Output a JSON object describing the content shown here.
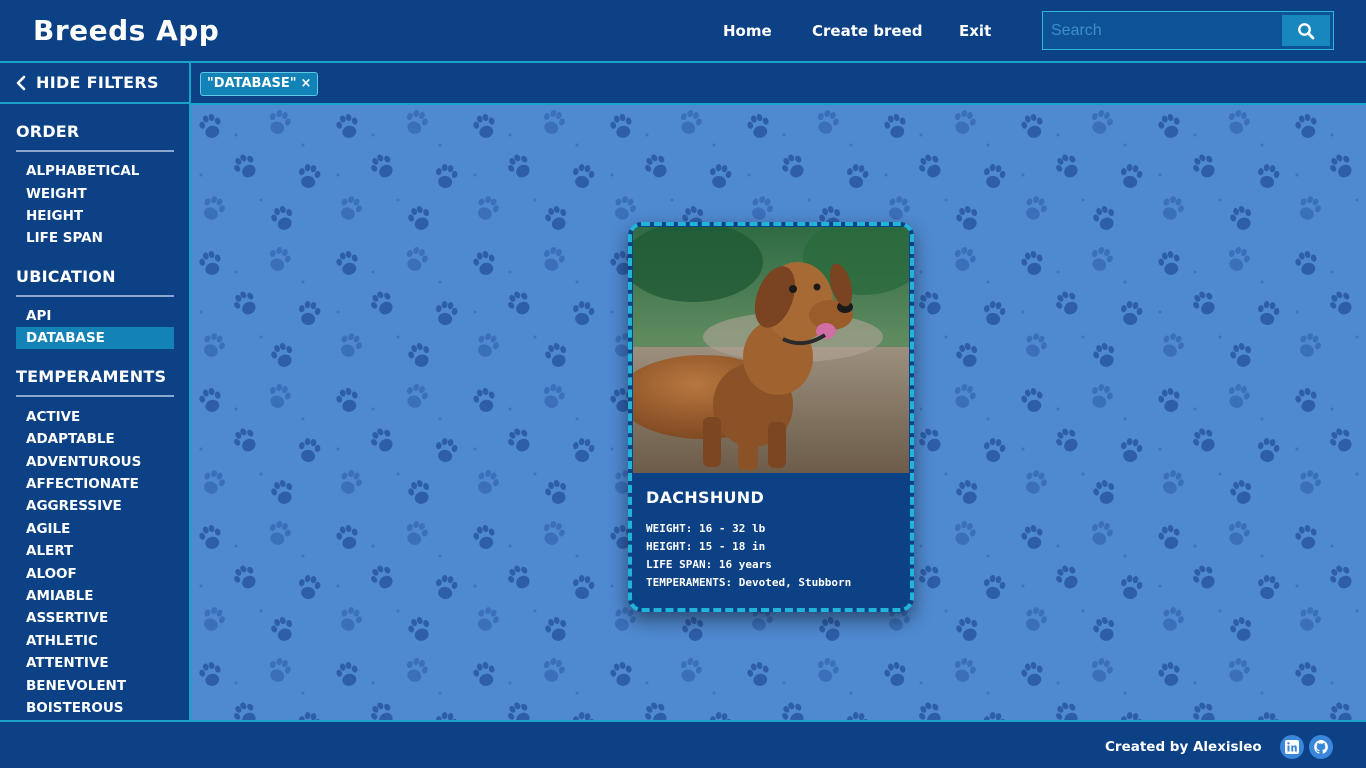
{
  "app": {
    "title": "Breeds App"
  },
  "nav": {
    "home": "Home",
    "create": "Create breed",
    "exit": "Exit"
  },
  "search": {
    "placeholder": "Search",
    "value": ""
  },
  "sidebar": {
    "toggle_label": "HIDE FILTERS",
    "order": {
      "title": "ORDER",
      "items": [
        "ALPHABETICAL",
        "WEIGHT",
        "HEIGHT",
        "LIFE SPAN"
      ]
    },
    "ubication": {
      "title": "UBICATION",
      "items": [
        "API",
        "DATABASE"
      ],
      "selected": "DATABASE"
    },
    "temperaments": {
      "title": "TEMPERAMENTS",
      "items": [
        "ACTIVE",
        "ADAPTABLE",
        "ADVENTUROUS",
        "AFFECTIONATE",
        "AGGRESSIVE",
        "AGILE",
        "ALERT",
        "ALOOF",
        "AMIABLE",
        "ASSERTIVE",
        "ATHLETIC",
        "ATTENTIVE",
        "BENEVOLENT",
        "BOISTEROUS"
      ]
    }
  },
  "active_filters": [
    {
      "label": "\"DATABASE\"",
      "close": "×"
    }
  ],
  "cards": [
    {
      "name": "DACHSHUND",
      "weight": "WEIGHT: 16 - 32 lb",
      "height": "HEIGHT: 15 - 18 in",
      "life_span": "LIFE SPAN: 16 years",
      "temperaments": "TEMPERAMENTS: Devoted, Stubborn"
    }
  ],
  "footer": {
    "credit": "Created by Alexisleo"
  },
  "colors": {
    "primary": "#0c4285",
    "accent": "#1aa3c8",
    "selected": "#1383b7",
    "background": "#4f89d0",
    "paw": "#2e5ea8"
  },
  "icons": {
    "search": "search-icon",
    "back": "chevron-left-icon",
    "linkedin": "linkedin-icon",
    "github": "github-icon"
  }
}
